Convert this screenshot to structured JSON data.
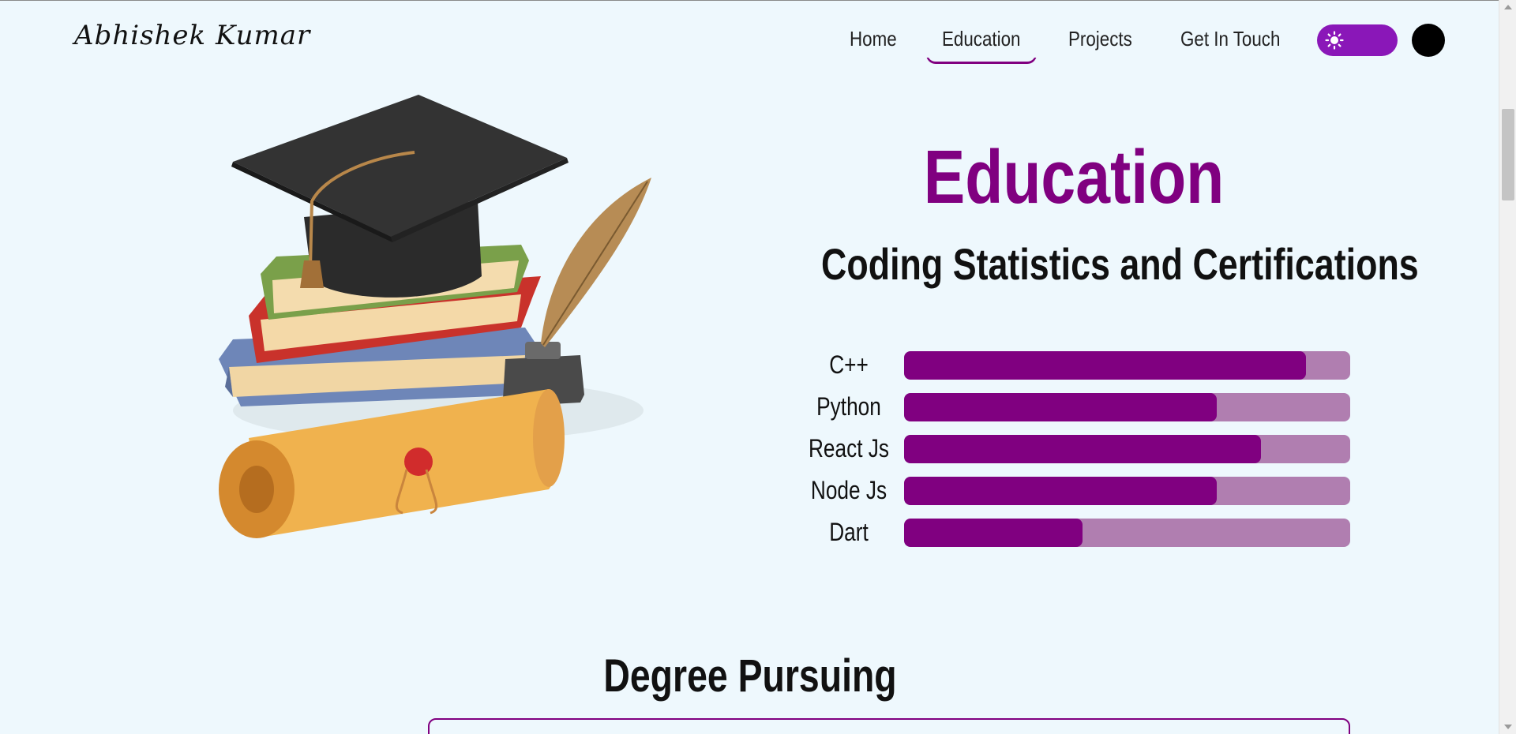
{
  "brand": {
    "name": "Abhishek Kumar"
  },
  "nav": {
    "items": [
      {
        "label": "Home",
        "active": false
      },
      {
        "label": "Education",
        "active": true
      },
      {
        "label": "Projects",
        "active": false
      },
      {
        "label": "Get In Touch",
        "active": false
      }
    ],
    "theme_toggle_icon": "sun-icon"
  },
  "colors": {
    "accent": "#800080",
    "accent_light": "#b07eb0",
    "toggle": "#8a17b8",
    "background": "#eef8fd"
  },
  "education": {
    "title": "Education",
    "subtitle": "Coding Statistics and Certifications",
    "skills": [
      {
        "label": "C++",
        "level": 0.9
      },
      {
        "label": "Python",
        "level": 0.7
      },
      {
        "label": "React Js",
        "level": 0.8
      },
      {
        "label": "Node Js",
        "level": 0.7
      },
      {
        "label": "Dart",
        "level": 0.4
      }
    ]
  },
  "degree": {
    "title": "Degree Pursuing"
  }
}
